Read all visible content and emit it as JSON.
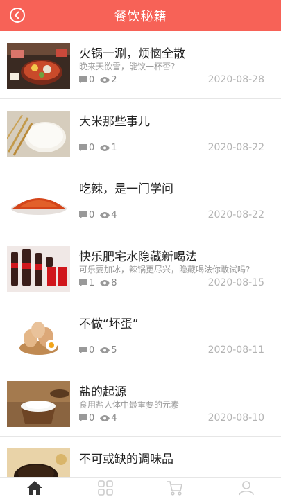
{
  "header": {
    "title": "餐饮秘籍"
  },
  "articles": [
    {
      "title": "火锅一涮，烦恼全散",
      "subtitle": "晚来天欲雪，能饮一杯否?",
      "comments": "0",
      "views": "2",
      "date": "2020-08-28"
    },
    {
      "title": "大米那些事儿",
      "subtitle": "",
      "comments": "0",
      "views": "1",
      "date": "2020-08-22"
    },
    {
      "title": "吃辣，是一门学问",
      "subtitle": "",
      "comments": "0",
      "views": "4",
      "date": "2020-08-22"
    },
    {
      "title": "快乐肥宅水隐藏新喝法",
      "subtitle": "可乐要加冰，辣锅更尽兴，隐藏喝法你敢试吗?",
      "comments": "1",
      "views": "8",
      "date": "2020-08-15"
    },
    {
      "title": "不做“坏蛋”",
      "subtitle": "",
      "comments": "0",
      "views": "5",
      "date": "2020-08-11"
    },
    {
      "title": "盐的起源",
      "subtitle": "食用盐人体中最重要的元素",
      "comments": "0",
      "views": "4",
      "date": "2020-08-10"
    },
    {
      "title": "不可或缺的调味品",
      "subtitle": "",
      "comments": "",
      "views": "",
      "date": ""
    }
  ],
  "colors": {
    "accent": "#f76257",
    "muted": "#b3b3b3"
  },
  "icons": {
    "back": "back-arrow-icon",
    "comment": "comment-icon",
    "view": "eye-icon",
    "home": "home-icon",
    "category": "grid-icon",
    "cart": "cart-icon",
    "profile": "user-icon"
  }
}
